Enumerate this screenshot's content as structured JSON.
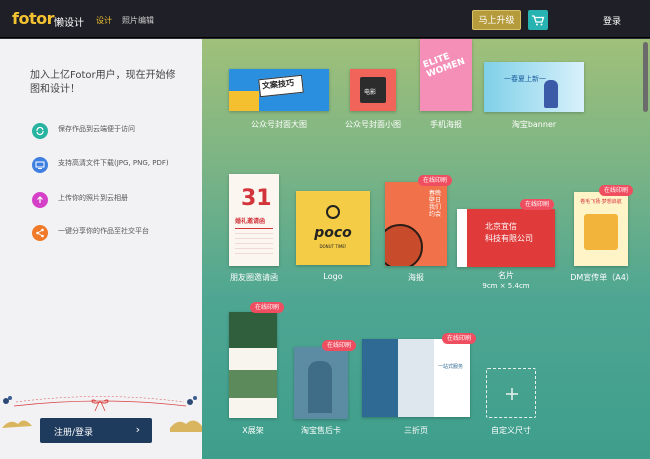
{
  "topbar": {
    "logo_text": "fotor",
    "logo_sub": "懒设计",
    "nav": [
      "设计",
      "照片编辑"
    ],
    "upgrade_label": "马上升级",
    "login_label": "登录"
  },
  "left": {
    "promo": "加入上亿Fotor用户，现在开始修图和设计！",
    "features": [
      {
        "text": "保存作品到云端便于访问",
        "icon": "cloud-sync-icon",
        "color": "#27b3a0"
      },
      {
        "text": "支持高清文件下载(JPG, PNG, PDF)",
        "icon": "monitor-download-icon",
        "color": "#3f7fe0"
      },
      {
        "text": "上传你的照片到云相册",
        "icon": "upload-arrow-icon",
        "color": "#d540c8"
      },
      {
        "text": "一键分享你的作品至社交平台",
        "icon": "share-icon",
        "color": "#f07a2a"
      }
    ],
    "register_label": "注册/登录",
    "register_arrow": "›"
  },
  "templates": {
    "row1": [
      "公众号封面大图",
      "公众号封面小图",
      "手机海报",
      "淘宝banner"
    ],
    "row2": [
      "朋友圈邀请函",
      "Logo",
      "海报",
      "名片",
      "DM宣传单（A4）"
    ],
    "row2_sub": "9cm × 5.4cm",
    "row3": [
      "X展架",
      "淘宝售后卡",
      "三折页",
      "自定义尺寸"
    ],
    "badge": "在线印刷",
    "thumb_text": {
      "wenan": "文案技巧",
      "dianying": "电影",
      "elite": "ELITE WOMEN",
      "taobao": "一春夏上新一",
      "invite_num": "31",
      "invite_title": "婚礼邀请函",
      "logo_word": "poco",
      "logo_small": "DONUT TIME!",
      "poster_cn": "春晚壁日我们约会",
      "card_line1": "北京宜信",
      "card_line2": "科技有限公司",
      "dm_title": "卷毛飞扬·梦想启航",
      "fold_title": "一站式服务"
    }
  }
}
